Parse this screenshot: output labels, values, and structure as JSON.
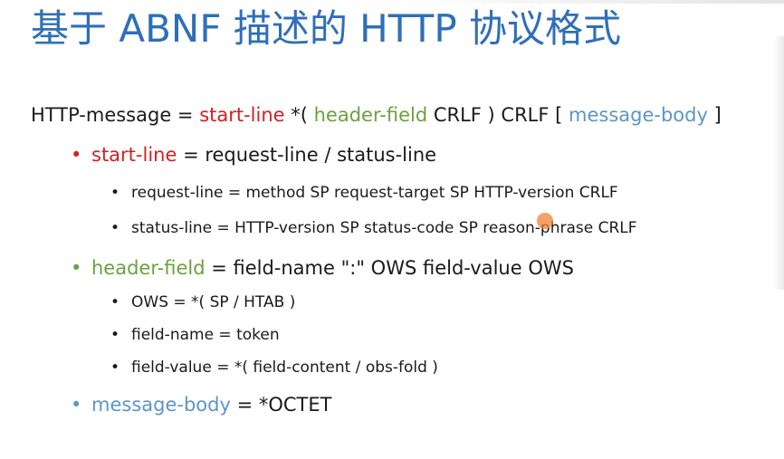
{
  "title": "基于 ABNF 描述的 HTTP 协议格式",
  "main": {
    "lhs": "HTTP-message",
    "eq": " = ",
    "start_line": "start-line",
    "star_open": " *( ",
    "header_field": "header-field",
    "crlf_close": " CRLF ) CRLF [ ",
    "message_body": "message-body",
    "close_bracket": " ]"
  },
  "start_line_def": {
    "bullet": "•",
    "name": "start-line",
    "rest": " = request-line / status-line",
    "items": [
      {
        "bullet": "•",
        "text": "request-line = method SP request-target SP HTTP-version CRLF"
      },
      {
        "bullet": "•",
        "text": "status-line = HTTP-version SP status-code SP reason-phrase CRLF"
      }
    ]
  },
  "header_field_def": {
    "bullet": "•",
    "name": "header-field",
    "rest": " = field-name \":\" OWS field-value OWS",
    "items": [
      {
        "bullet": "•",
        "text": "OWS = *( SP / HTAB )"
      },
      {
        "bullet": "•",
        "text": "field-name = token"
      },
      {
        "bullet": "•",
        "text": "field-value = *( field-content / obs-fold )"
      }
    ]
  },
  "message_body_def": {
    "bullet": "•",
    "name": "message-body",
    "rest": " = *OCTET"
  },
  "colors": {
    "title": "#2f6fb7",
    "start_line": "#d42020",
    "header_field": "#6aa23d",
    "message_body": "#5b96c6",
    "cursor": "#f0823a"
  }
}
